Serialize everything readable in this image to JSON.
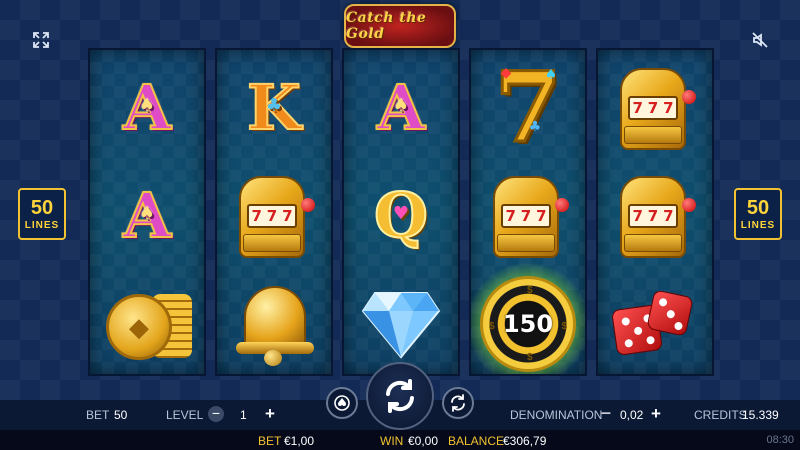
{
  "game": {
    "logo_text": "Catch the Gold"
  },
  "icons": {
    "fullscreen": "fullscreen-icon",
    "sound": "sound-muted-icon"
  },
  "lines_badge": {
    "number": "50",
    "label": "LINES"
  },
  "reels": [
    [
      "A",
      "A",
      "coins"
    ],
    [
      "K",
      "slot-machine",
      "bell"
    ],
    [
      "A",
      "Q",
      "diamond"
    ],
    [
      "7",
      "slot-machine",
      "chip"
    ],
    [
      "slot-machine",
      "slot-machine",
      "dice"
    ]
  ],
  "symbols": {
    "slot_machine_reels": [
      "7",
      "7",
      "7"
    ],
    "chip_value": "150",
    "chip_currency": "$"
  },
  "controls": {
    "bet_label": "BET",
    "bet_value": "50",
    "level_label": "LEVEL",
    "level_value": "1",
    "minus": "−",
    "plus": "+",
    "denomination_label": "DENOMINATION",
    "denomination_value": "0,02",
    "credits_label": "CREDITS",
    "credits_value": "15.339"
  },
  "status": {
    "bet_label": "BET",
    "bet_value": "€1,00",
    "win_label": "WIN",
    "win_value": "€0,00",
    "balance_label": "BALANCE",
    "balance_value": "€306,79",
    "time": "08:30"
  },
  "colors": {
    "background": "#122a55",
    "accent_gold": "#f2c230",
    "chip_glow": "#c8ff3c"
  }
}
